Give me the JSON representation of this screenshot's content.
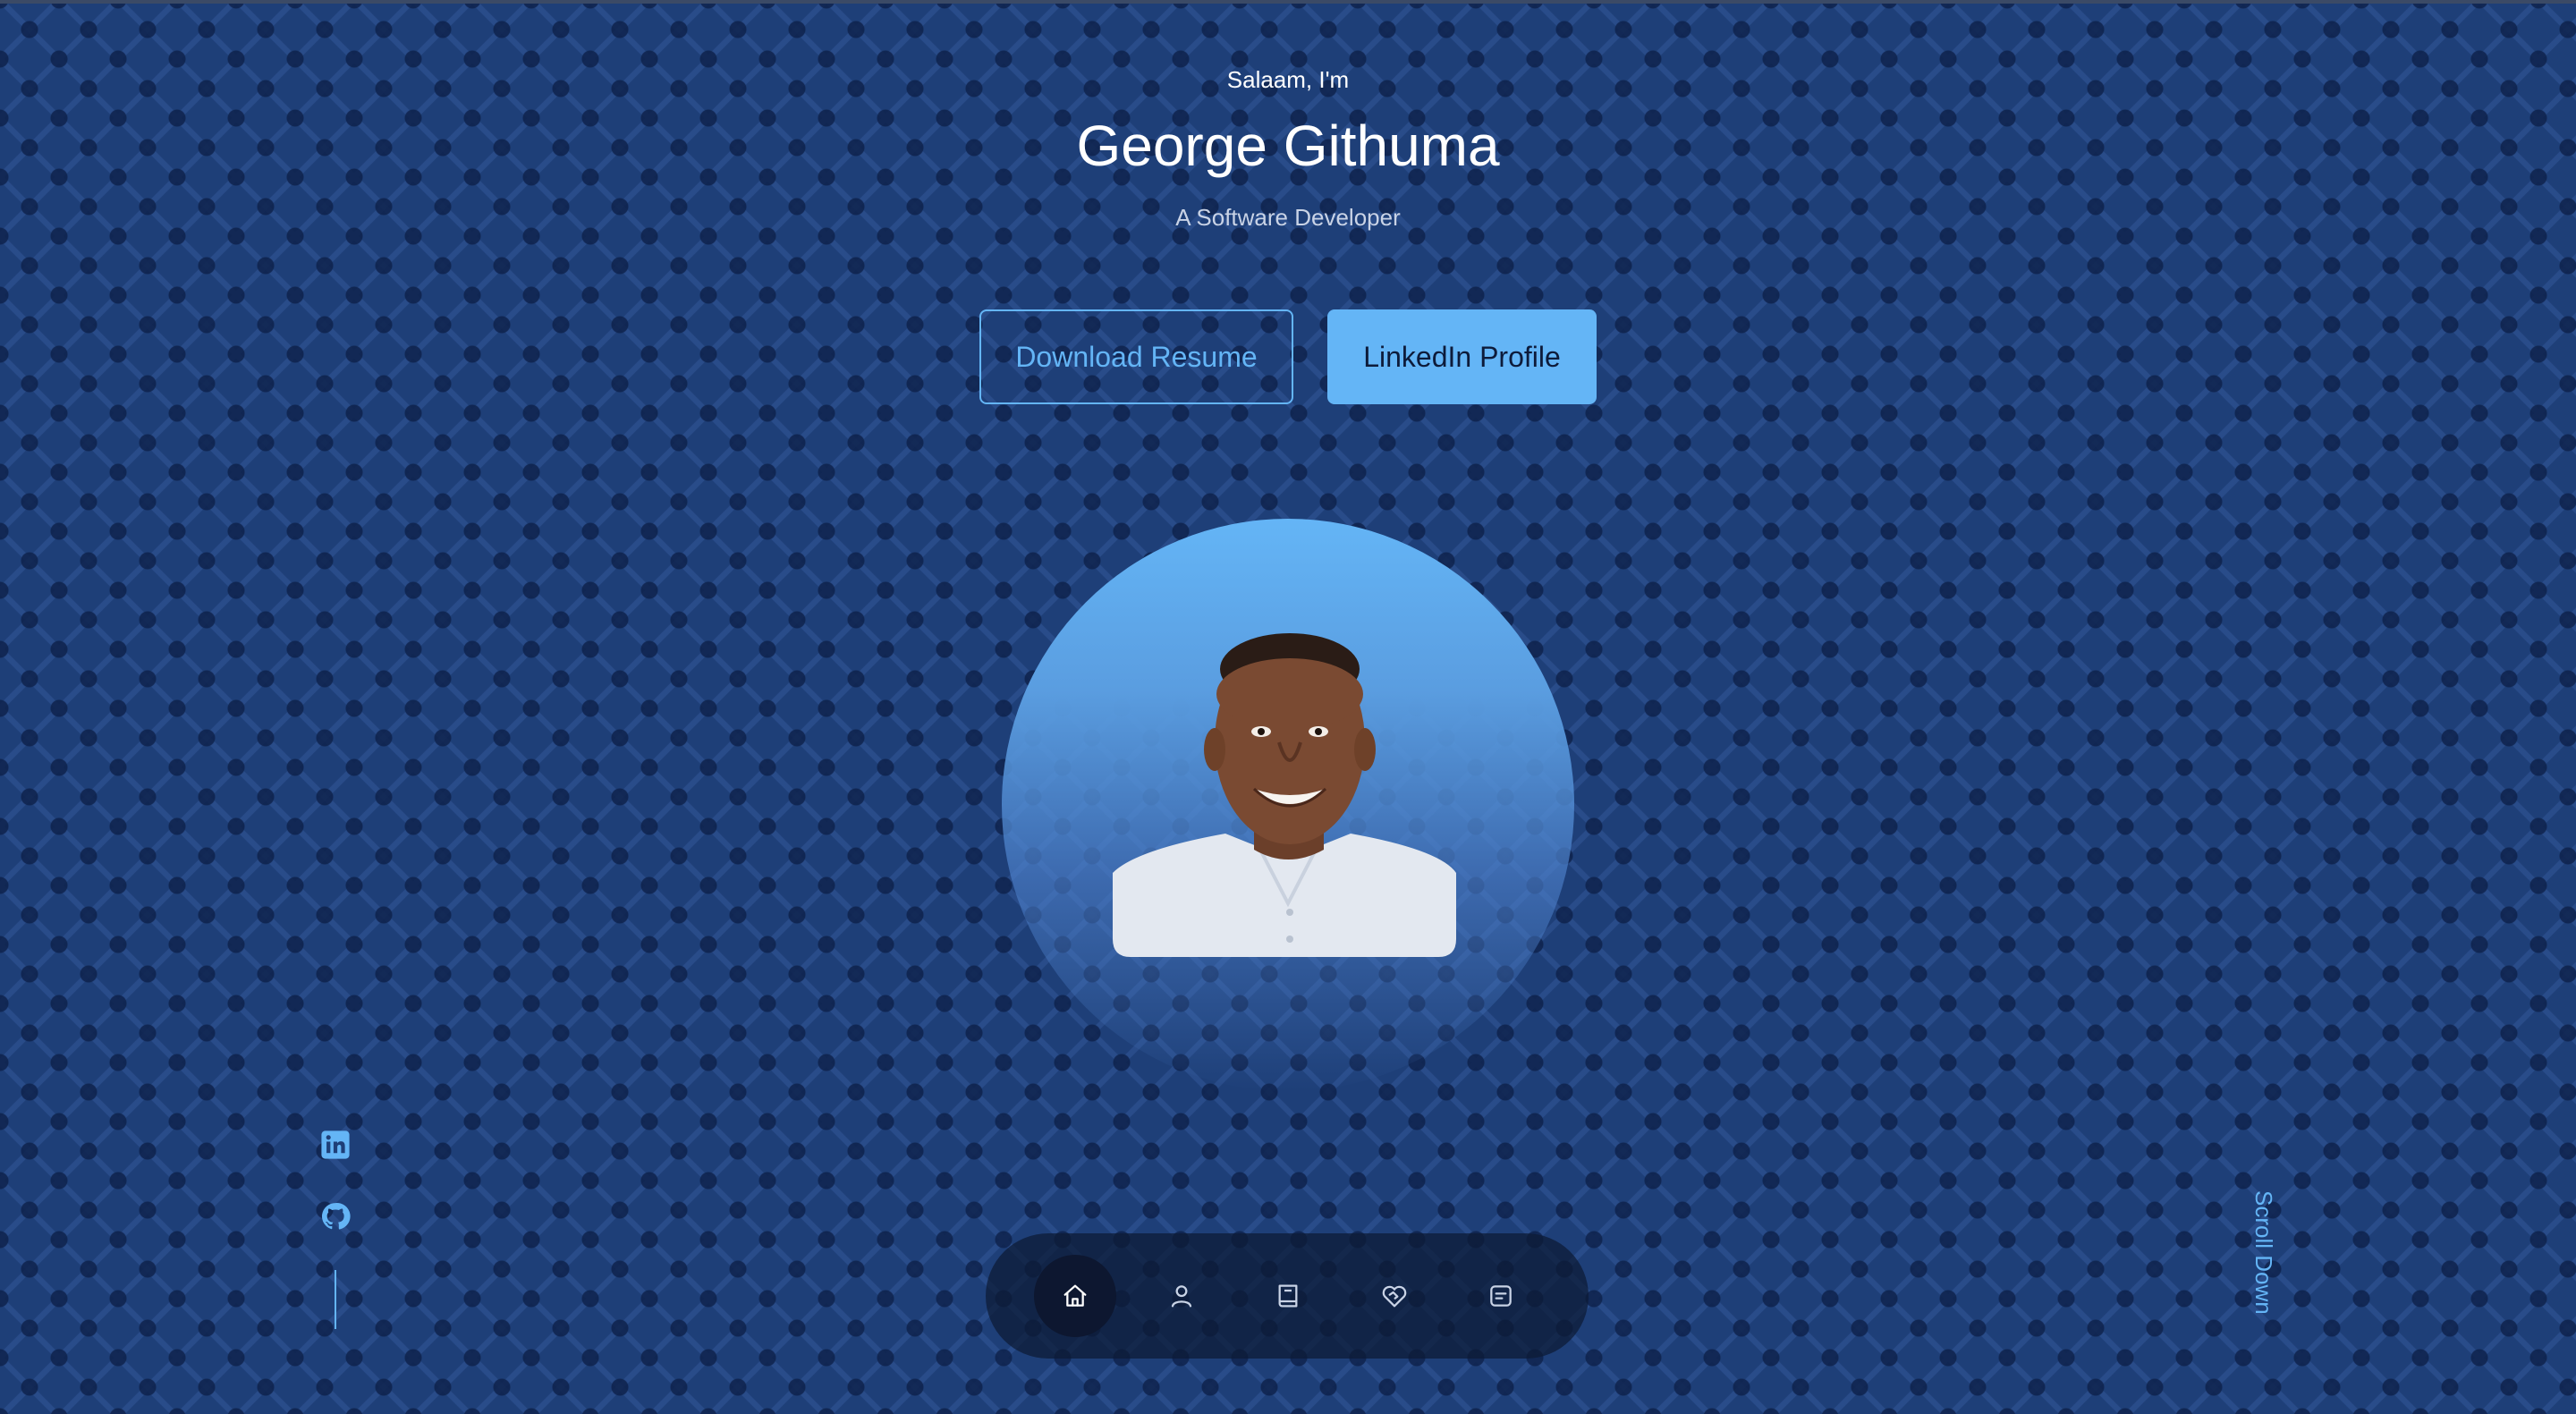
{
  "hero": {
    "greeting": "Salaam, I'm",
    "name": "George Githuma",
    "role": "A Software Developer"
  },
  "actions": {
    "download_resume": "Download Resume",
    "linkedin_profile": "LinkedIn Profile"
  },
  "social": {
    "items": [
      {
        "icon": "linkedin-icon"
      },
      {
        "icon": "github-icon"
      }
    ]
  },
  "scroll_hint": "Scroll Down",
  "nav": {
    "items": [
      {
        "icon": "home-icon",
        "active": true
      },
      {
        "icon": "user-icon",
        "active": false
      },
      {
        "icon": "book-icon",
        "active": false
      },
      {
        "icon": "handshake-icon",
        "active": false
      },
      {
        "icon": "message-icon",
        "active": false
      }
    ]
  },
  "colors": {
    "accent": "#64b5f6",
    "background": "#1e3f78",
    "dock": "#0d1a34"
  }
}
